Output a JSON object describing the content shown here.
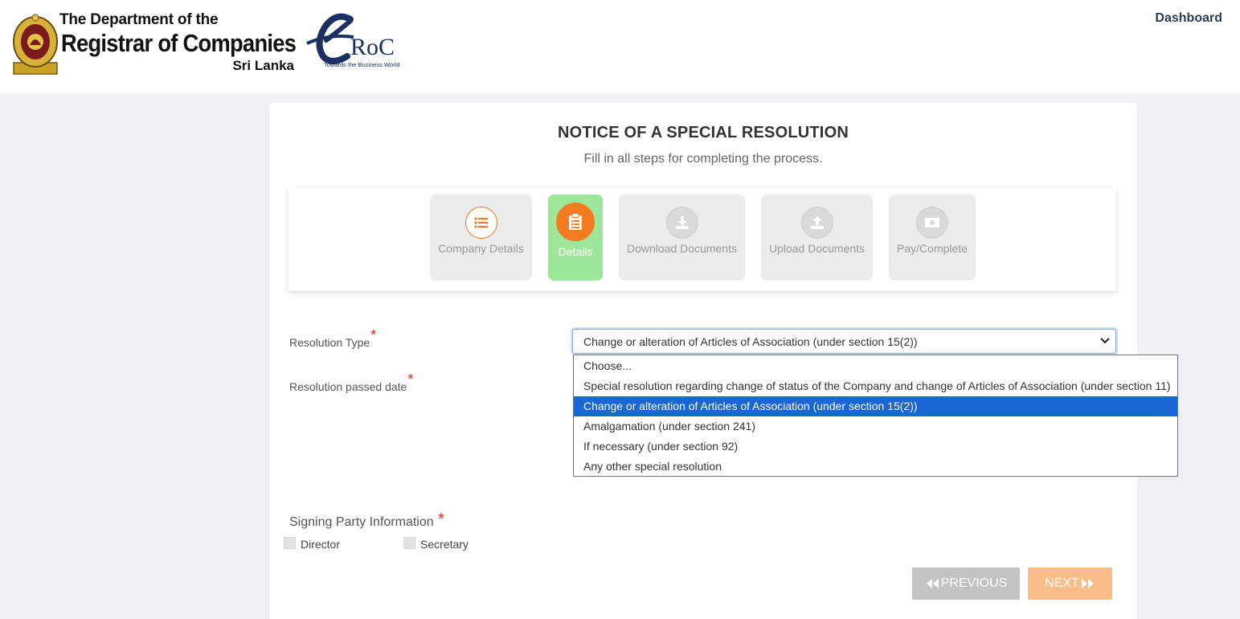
{
  "header": {
    "brand_line1": "The Department of the",
    "brand_line2": "Registrar of Companies",
    "brand_line3": "Sri Lanka",
    "eroc_text": "RoC",
    "eroc_tagline": "Towards the Business World",
    "dashboard_link": "Dashboard"
  },
  "page": {
    "title": "NOTICE OF A SPECIAL RESOLUTION",
    "subtitle": "Fill in all steps for completing the process."
  },
  "steps": [
    {
      "label": "Company Details",
      "icon": "list-icon",
      "state": "done"
    },
    {
      "label": "Details",
      "icon": "clipboard-icon",
      "state": "active"
    },
    {
      "label": "Download Documents",
      "icon": "download-icon",
      "state": "pending"
    },
    {
      "label": "Upload Documents",
      "icon": "upload-icon",
      "state": "pending"
    },
    {
      "label": "Pay/Complete",
      "icon": "money-icon",
      "state": "pending"
    }
  ],
  "form": {
    "resolution_type_label": "Resolution Type",
    "resolution_date_label": "Resolution passed date",
    "required_mark": "*",
    "resolution_type_selected": "Change or alteration of Articles of Association (under section 15(2))",
    "resolution_type_options": [
      "Choose...",
      "Special resolution regarding change of status of the Company and change of Articles of Association (under section 11)",
      "Change or alteration of Articles of Association (under section 15(2))",
      "Amalgamation (under section 241)",
      "If necessary (under section 92)",
      "Any other special resolution"
    ],
    "selected_index": 2,
    "signing_party_title": "Signing Party Information",
    "signing_options": [
      "Director",
      "Secretary"
    ]
  },
  "nav": {
    "previous_label": "PREVIOUS",
    "next_label": "NEXT"
  },
  "colors": {
    "accent_orange": "#f47b20",
    "active_step_bg": "#9de79a",
    "selected_option": "#1a66d6",
    "required": "#e0291c"
  }
}
